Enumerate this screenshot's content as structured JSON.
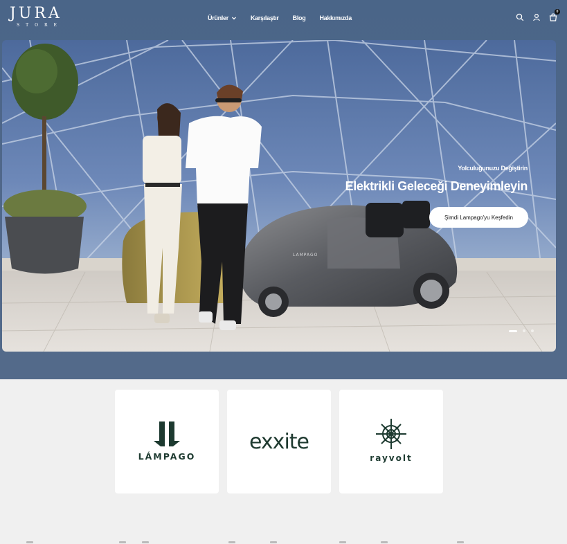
{
  "header": {
    "logo_text": "JURA",
    "logo_sub": "STORE",
    "nav": [
      {
        "label": "Ürünler",
        "has_dropdown": true
      },
      {
        "label": "Karşılaştır"
      },
      {
        "label": "Blog"
      },
      {
        "label": "Hakkımızda"
      }
    ],
    "cart_count": "0",
    "icons": [
      "search-icon",
      "account-icon",
      "cart-icon"
    ]
  },
  "hero": {
    "kicker": "Yolculuğunuzu Değiştirin",
    "title": "Elektrikli Geleceği Deneyimleyin",
    "cta_label": "Şimdi Lampago'yu Keşfedin",
    "vehicle_badge": "LAMPAGO",
    "slides": 3,
    "active_slide": 1
  },
  "brands": [
    {
      "name": "LÁMPAGO"
    },
    {
      "name": "exxite"
    },
    {
      "name": "rayvolt"
    }
  ],
  "colors": {
    "header_bg": "#4a6588",
    "brand_green": "#1d3a30",
    "page_bg": "#f0f0f0"
  }
}
